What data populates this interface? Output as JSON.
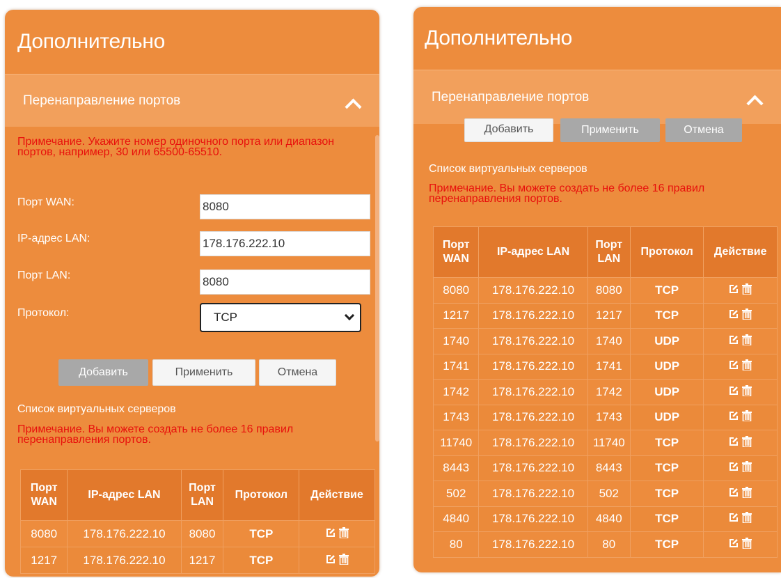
{
  "title": "Дополнительно",
  "section": "Перенаправление портов",
  "form": {
    "note": "Примечание. Укажите номер одиночного порта или диапазон портов, например, 30 или 65500-65510.",
    "wan_port_label": "Порт WAN:",
    "wan_port_value": "8080",
    "lan_ip_label": "IP-адрес LAN:",
    "lan_ip_value": "178.176.222.10",
    "lan_port_label": "Порт LAN:",
    "lan_port_value": "8080",
    "protocol_label": "Протокол:",
    "protocol_value": "TCP"
  },
  "buttons": {
    "add": "Добавить",
    "apply": "Применить",
    "cancel": "Отмена"
  },
  "servers": {
    "title": "Список виртуальных серверов",
    "note": "Примечание. Вы можете создать не более 16 правил перенаправления портов."
  },
  "table": {
    "headers": {
      "wan_port_1": "Порт",
      "wan_port_2": "WAN",
      "lan_ip": "IP-адрес LAN",
      "lan_port_1": "Порт",
      "lan_port_2": "LAN",
      "protocol": "Протокол",
      "action": "Действие"
    },
    "rows": [
      {
        "wan": "8080",
        "ip": "178.176.222.10",
        "lan": "8080",
        "proto": "TCP"
      },
      {
        "wan": "1217",
        "ip": "178.176.222.10",
        "lan": "1217",
        "proto": "TCP"
      },
      {
        "wan": "1740",
        "ip": "178.176.222.10",
        "lan": "1740",
        "proto": "UDP"
      },
      {
        "wan": "1741",
        "ip": "178.176.222.10",
        "lan": "1741",
        "proto": "UDP"
      },
      {
        "wan": "1742",
        "ip": "178.176.222.10",
        "lan": "1742",
        "proto": "UDP"
      },
      {
        "wan": "1743",
        "ip": "178.176.222.10",
        "lan": "1743",
        "proto": "UDP"
      },
      {
        "wan": "11740",
        "ip": "178.176.222.10",
        "lan": "11740",
        "proto": "TCP"
      },
      {
        "wan": "8443",
        "ip": "178.176.222.10",
        "lan": "8443",
        "proto": "TCP"
      },
      {
        "wan": "502",
        "ip": "178.176.222.10",
        "lan": "502",
        "proto": "TCP"
      },
      {
        "wan": "4840",
        "ip": "178.176.222.10",
        "lan": "4840",
        "proto": "TCP"
      },
      {
        "wan": "80",
        "ip": "178.176.222.10",
        "lan": "80",
        "proto": "TCP"
      }
    ]
  },
  "icons": {
    "chevron": "chevron-up-icon",
    "edit": "edit-icon",
    "delete": "trash-icon"
  },
  "colors": {
    "panel": "#ed8c3d",
    "header": "#f2a05c",
    "note": "#e8100c"
  }
}
